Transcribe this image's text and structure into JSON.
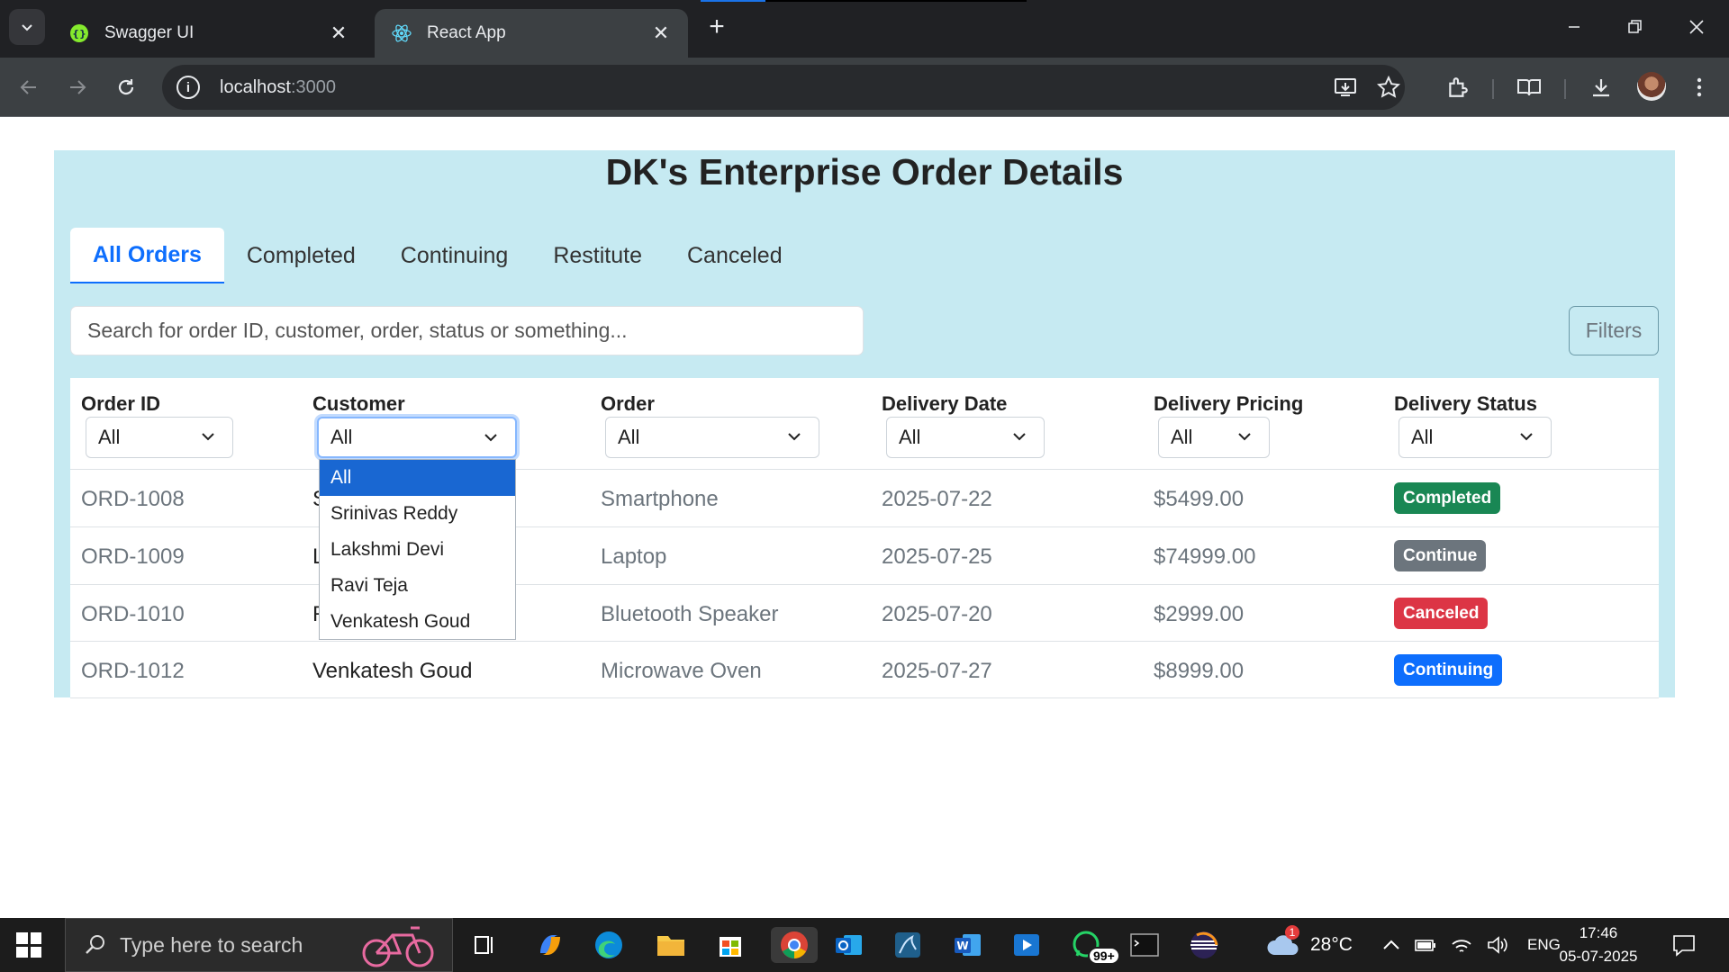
{
  "browser": {
    "tabs": [
      {
        "title": "Swagger UI",
        "active": false
      },
      {
        "title": "React App",
        "active": true
      }
    ],
    "url_host": "localhost",
    "url_port": ":3000"
  },
  "page": {
    "title": "DK's Enterprise Order Details",
    "tabs": [
      "All Orders",
      "Completed",
      "Continuing",
      "Restitute",
      "Canceled"
    ],
    "active_tab": "All Orders",
    "search_placeholder": "Search for order ID, customer, order, status or something...",
    "filters_label": "Filters"
  },
  "table": {
    "columns": [
      {
        "label": "Order ID",
        "filter": "All"
      },
      {
        "label": "Customer",
        "filter": "All"
      },
      {
        "label": "Order",
        "filter": "All"
      },
      {
        "label": "Delivery Date",
        "filter": "All"
      },
      {
        "label": "Delivery Pricing",
        "filter": "All"
      },
      {
        "label": "Delivery Status",
        "filter": "All"
      }
    ],
    "rows": [
      {
        "order_id": "ORD-1008",
        "customer": "S",
        "order": "Smartphone",
        "date": "2025-07-22",
        "price": "$5499.00",
        "status": "Completed",
        "status_color": "#198754"
      },
      {
        "order_id": "ORD-1009",
        "customer": "L",
        "order": "Laptop",
        "date": "2025-07-25",
        "price": "$74999.00",
        "status": "Continue",
        "status_color": "#6c757d"
      },
      {
        "order_id": "ORD-1010",
        "customer": "R",
        "order": "Bluetooth Speaker",
        "date": "2025-07-20",
        "price": "$2999.00",
        "status": "Canceled",
        "status_color": "#dc3545"
      },
      {
        "order_id": "ORD-1012",
        "customer": "Venkatesh Goud",
        "order": "Microwave Oven",
        "date": "2025-07-27",
        "price": "$8999.00",
        "status": "Continuing",
        "status_color": "#0d6efd"
      }
    ]
  },
  "customer_dropdown": {
    "options": [
      "All",
      "Srinivas Reddy",
      "Lakshmi Devi",
      "Ravi Teja",
      "Venkatesh Goud"
    ],
    "selected": "All"
  },
  "taskbar": {
    "search_placeholder": "Type here to search",
    "weather_temp": "28°C",
    "weather_badge": "1",
    "whatsapp_badge": "99+",
    "language": "ENG",
    "time": "17:46",
    "date": "05-07-2025"
  }
}
